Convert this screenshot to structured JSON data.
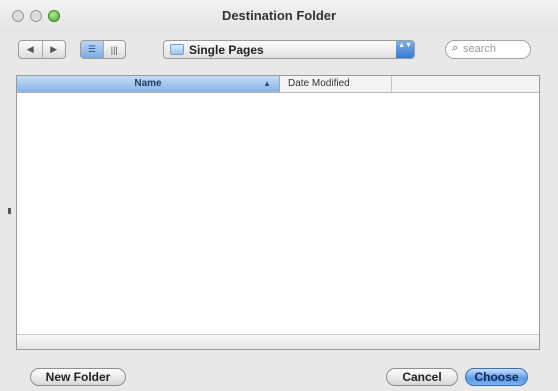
{
  "window": {
    "title": "Destination Folder"
  },
  "toolbar": {
    "back_icon": "◀",
    "forward_icon": "▶",
    "list_view_icon": "☰",
    "column_view_icon": "|||",
    "location": "Single Pages",
    "location_arrows": "▲▼",
    "search_placeholder": "search"
  },
  "browser": {
    "columns": {
      "name": "Name",
      "date": "Date Modified"
    },
    "items": []
  },
  "buttons": {
    "new_folder": "New Folder",
    "cancel": "Cancel",
    "choose": "Choose"
  }
}
